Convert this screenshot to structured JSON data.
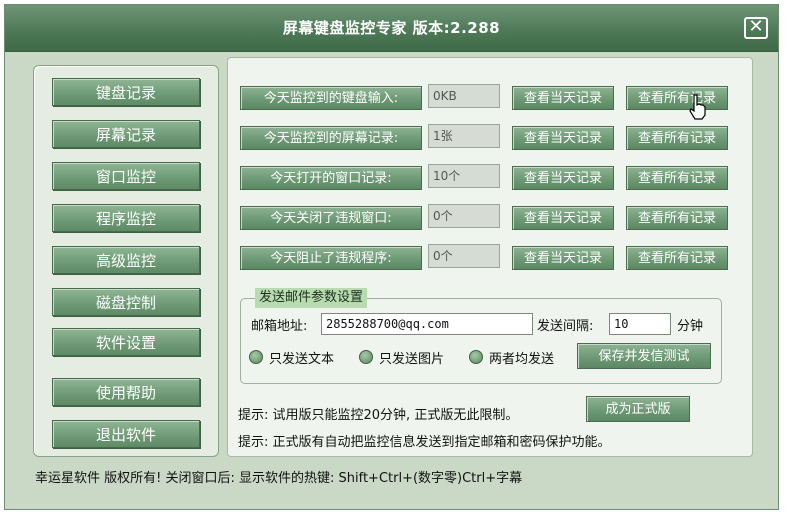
{
  "window": {
    "title": "屏幕键盘监控专家 版本:2.288",
    "close_icon": "✕"
  },
  "sidebar": {
    "items": [
      {
        "label": "键盘记录"
      },
      {
        "label": "屏幕记录"
      },
      {
        "label": "窗口监控"
      },
      {
        "label": "程序监控"
      },
      {
        "label": "高级监控"
      },
      {
        "label": "磁盘控制"
      },
      {
        "label": "软件设置"
      },
      {
        "label": "使用帮助"
      },
      {
        "label": "退出软件"
      }
    ]
  },
  "monitor_rows": [
    {
      "label": "今天监控到的键盘输入:",
      "value": "0KB",
      "today_label": "查看当天记录",
      "all_label": "查看所有记录"
    },
    {
      "label": "今天监控到的屏幕记录:",
      "value": "1张",
      "today_label": "查看当天记录",
      "all_label": "查看所有记录"
    },
    {
      "label": "今天打开的窗口记录:",
      "value": "10个",
      "today_label": "查看当天记录",
      "all_label": "查看所有记录"
    },
    {
      "label": "今天关闭了违规窗口:",
      "value": "0个",
      "today_label": "查看当天记录",
      "all_label": "查看所有记录"
    },
    {
      "label": "今天阻止了违规程序:",
      "value": "0个",
      "today_label": "查看当天记录",
      "all_label": "查看所有记录"
    }
  ],
  "email_settings": {
    "legend": "发送邮件参数设置",
    "email_label": "邮箱地址:",
    "email_value": "2855288700@qq.com",
    "interval_label": "发送间隔:",
    "interval_value": "10",
    "interval_unit": "分钟",
    "options": [
      "只发送文本",
      "只发送图片",
      "两者均发送"
    ],
    "save_test_label": "保存并发信测试"
  },
  "tips": {
    "line1": "提示: 试用版只能监控20分钟, 正式版无此限制。",
    "upgrade_label": "成为正式版",
    "line2": "提示: 正式版有自动把监控信息发送到指定邮箱和密码保护功能。"
  },
  "status_bar": {
    "text": "幸运星软件 版权所有! 关闭窗口后: 显示软件的热键: Shift+Ctrl+(数字零)Ctrl+字幕"
  },
  "colors": {
    "title_bar": "#4e7a58",
    "button_green": "#6d9a75",
    "window_bg": "#c9d9c6",
    "legend_bg": "#b8dcb0"
  }
}
